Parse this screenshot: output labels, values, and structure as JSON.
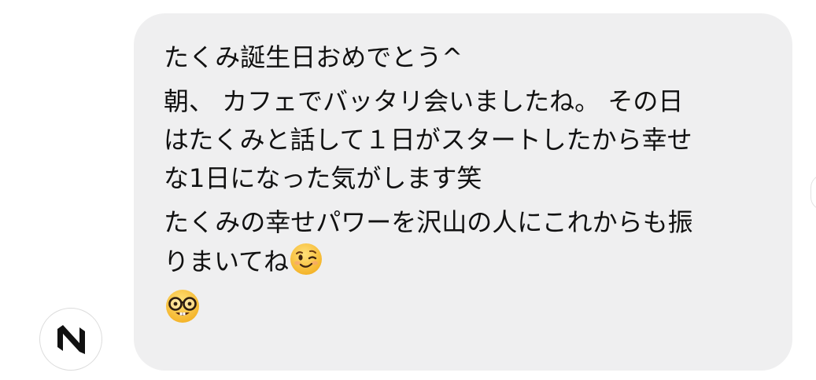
{
  "message": {
    "lines": [
      "たくみ誕生日おめでとう^",
      "朝、 カフェでバッタリ会いましたね。 その日",
      "はたくみと話して１日がスタートしたから幸せ",
      "な1日になった気がします笑",
      "たくみの幸せパワーを沢山の人にこれからも振",
      "りまいてね"
    ],
    "emoji_inline": "winking-face",
    "emoji_last": "nerd-face"
  },
  "avatar": {
    "icon": "brand-logo"
  },
  "colors": {
    "bubble_bg": "#efeff0",
    "text": "#111111",
    "emoji_yellow": "#f7c33c"
  }
}
